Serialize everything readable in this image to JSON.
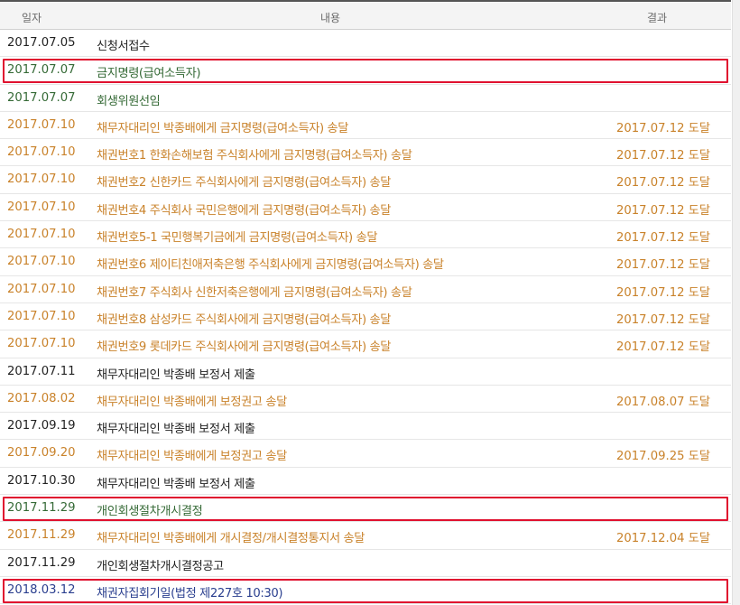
{
  "header": {
    "date": "일자",
    "content": "내용",
    "result": "결과"
  },
  "rows": [
    {
      "date": "2017.07.05",
      "content": "신청서접수",
      "result": "",
      "color": "black"
    },
    {
      "date": "2017.07.07",
      "content": "금지명령(급여소득자)",
      "result": "",
      "color": "green",
      "highlighted": true
    },
    {
      "date": "2017.07.07",
      "content": "회생위원선임",
      "result": "",
      "color": "green"
    },
    {
      "date": "2017.07.10",
      "content": "채무자대리인 박종배에게 금지명령(급여소득자) 송달",
      "result": "2017.07.12 도달",
      "color": "orange"
    },
    {
      "date": "2017.07.10",
      "content": "채권번호1 한화손해보험 주식회사에게 금지명령(급여소득자) 송달",
      "result": "2017.07.12 도달",
      "color": "orange"
    },
    {
      "date": "2017.07.10",
      "content": "채권번호2 신한카드 주식회사에게 금지명령(급여소득자) 송달",
      "result": "2017.07.12 도달",
      "color": "orange"
    },
    {
      "date": "2017.07.10",
      "content": "채권번호4 주식회사 국민은행에게 금지명령(급여소득자) 송달",
      "result": "2017.07.12 도달",
      "color": "orange"
    },
    {
      "date": "2017.07.10",
      "content": "채권번호5-1 국민행복기금에게 금지명령(급여소득자) 송달",
      "result": "2017.07.12 도달",
      "color": "orange"
    },
    {
      "date": "2017.07.10",
      "content": "채권번호6 제이티친애저축은행 주식회사에게 금지명령(급여소득자) 송달",
      "result": "2017.07.12 도달",
      "color": "orange"
    },
    {
      "date": "2017.07.10",
      "content": "채권번호7 주식회사 신한저축은행에게 금지명령(급여소득자) 송달",
      "result": "2017.07.12 도달",
      "color": "orange"
    },
    {
      "date": "2017.07.10",
      "content": "채권번호8 삼성카드 주식회사에게 금지명령(급여소득자) 송달",
      "result": "2017.07.12 도달",
      "color": "orange"
    },
    {
      "date": "2017.07.10",
      "content": "채권번호9 롯데카드 주식회사에게 금지명령(급여소득자) 송달",
      "result": "2017.07.12 도달",
      "color": "orange"
    },
    {
      "date": "2017.07.11",
      "content": "채무자대리인 박종배 보정서 제출",
      "result": "",
      "color": "black"
    },
    {
      "date": "2017.08.02",
      "content": "채무자대리인 박종배에게 보정권고 송달",
      "result": "2017.08.07 도달",
      "color": "orange"
    },
    {
      "date": "2017.09.19",
      "content": "채무자대리인 박종배 보정서 제출",
      "result": "",
      "color": "black"
    },
    {
      "date": "2017.09.20",
      "content": "채무자대리인 박종배에게 보정권고 송달",
      "result": "2017.09.25 도달",
      "color": "orange"
    },
    {
      "date": "2017.10.30",
      "content": "채무자대리인 박종배 보정서 제출",
      "result": "",
      "color": "black"
    },
    {
      "date": "2017.11.29",
      "content": "개인회생절차개시결정",
      "result": "",
      "color": "green",
      "highlighted": true
    },
    {
      "date": "2017.11.29",
      "content": "채무자대리인 박종배에게 개시결정/개시결정통지서 송달",
      "result": "2017.12.04 도달",
      "color": "orange"
    },
    {
      "date": "2017.11.29",
      "content": "개인회생절차개시결정공고",
      "result": "",
      "color": "black"
    },
    {
      "date": "2018.03.12",
      "content": "채권자집회기일(법정 제227호 10:30)",
      "result": "",
      "color": "blue",
      "highlighted": true
    }
  ],
  "colors": {
    "black": "#222222",
    "green": "#356a36",
    "orange": "#c9822a",
    "blue": "#2a3f8f",
    "highlight": "#e0112f"
  }
}
